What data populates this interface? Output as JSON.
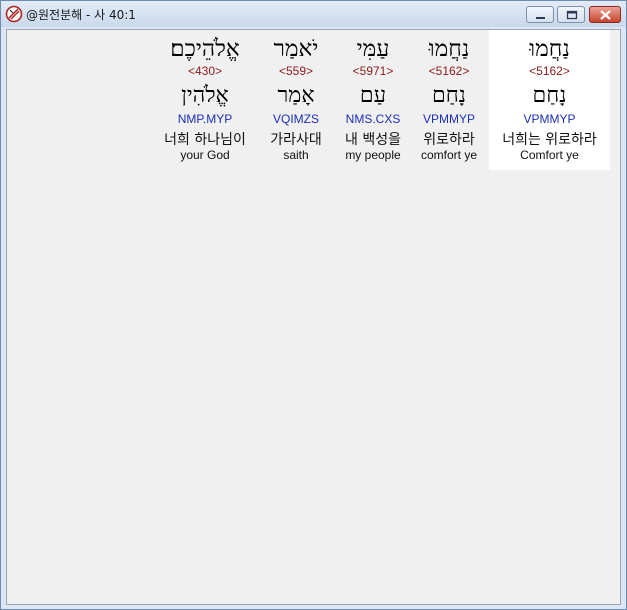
{
  "window": {
    "title": "@원전분해 - 사 40:1",
    "controls": {
      "minimize_icon": "minimize-icon",
      "maximize_icon": "maximize-icon",
      "close_icon": "close-icon"
    }
  },
  "words": [
    {
      "hebrew": "נַחֲמוּ",
      "strong": "<5162>",
      "lemma": "נָחַם",
      "parsing": "VPMMYP",
      "korean": "너희는 위로하라",
      "english": "Comfort ye",
      "selected": true
    },
    {
      "hebrew": "נַחֲמוּ",
      "strong": "<5162>",
      "lemma": "נָחַם",
      "parsing": "VPMMYP",
      "korean": "위로하라",
      "english": "comfort ye",
      "selected": false
    },
    {
      "hebrew": "עַמִּי",
      "strong": "<5971>",
      "lemma": "עַם",
      "parsing": "NMS.CXS",
      "korean": "내 백성을",
      "english": "my people",
      "selected": false
    },
    {
      "hebrew": "יֹאמַר",
      "strong": "<559>",
      "lemma": "אָמַר",
      "parsing": "VQIMZS",
      "korean": "가라사대",
      "english": "saith",
      "selected": false
    },
    {
      "hebrew": "אֱלֹהֵיכֶם׃",
      "strong": "<430>",
      "lemma": "אֱלֹהִין",
      "parsing": "NMP.MYP",
      "korean": "너희 하나님이",
      "english": "your God",
      "selected": false
    }
  ],
  "colors": {
    "strong": "#8b1a1a",
    "parsing": "#1c2fb5",
    "selected_bg": "#ffffff",
    "client_bg": "#f0f0f0"
  }
}
